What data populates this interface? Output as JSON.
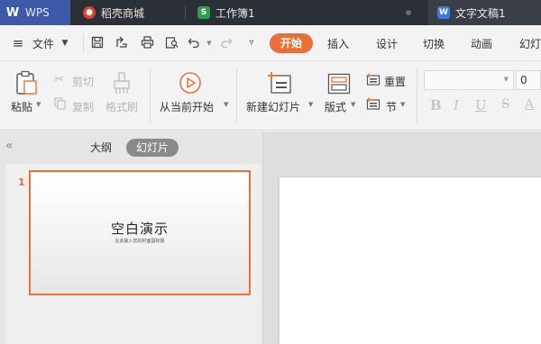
{
  "tabs": {
    "app": "WPS",
    "items": [
      {
        "label": "稻壳商城"
      },
      {
        "label": "工作簿1"
      },
      {
        "label": "文字文稿1"
      }
    ]
  },
  "menu": {
    "file": "文件",
    "items": [
      "开始",
      "插入",
      "设计",
      "切换",
      "动画",
      "幻灯"
    ]
  },
  "ribbon": {
    "paste": "粘贴",
    "cut": "剪切",
    "copy": "复制",
    "format_painter": "格式刷",
    "from_current": "从当前开始",
    "new_slide": "新建幻灯片",
    "layout": "版式",
    "reset": "重置",
    "section": "节",
    "font_size": "0"
  },
  "panel": {
    "tab_outline": "大纲",
    "tab_slides": "幻灯片",
    "slide_number": "1",
    "thumb_title": "空白演示",
    "thumb_subtitle": "在此输入您的封面副标题"
  },
  "colors": {
    "accent": "#e8703a",
    "tabbar": "#2b2f36",
    "wps_tab": "#3d5aa8"
  }
}
